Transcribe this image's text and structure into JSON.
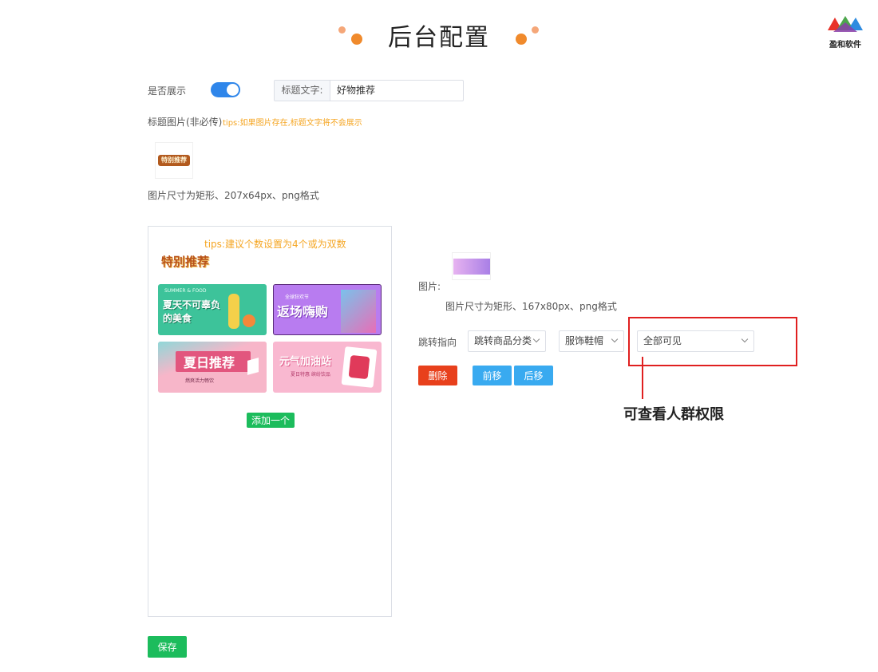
{
  "header": {
    "title": "后台配置",
    "logo_text": "盈和软件",
    "accent_color": "#f08a2c"
  },
  "display_toggle": {
    "label": "是否展示",
    "on": true
  },
  "title_text": {
    "prefix": "标题文字:",
    "value": "好物推荐"
  },
  "title_image": {
    "label": "标题图片(非必传)",
    "tip": "tips:如果图片存在,标题文字将不会展示",
    "thumb_text": "特别推荐",
    "size_hint": "图片尺寸为矩形、207x64px、png格式"
  },
  "preview": {
    "tip": "tips:建议个数设置为4个或为双数",
    "title_img_text": "特别推荐",
    "banners": [
      {
        "text": "夏天不可辜负的美食",
        "sub": "SUMMER & FOOD",
        "bg": "#3dc39a"
      },
      {
        "text": "返场嗨购",
        "sub": "全球狂欢节",
        "bg": "#b87cf0"
      },
      {
        "text": "夏日推荐",
        "sub": "燃爽活力畅饮",
        "bg": "#f7b6c9"
      },
      {
        "text": "元气加油站",
        "sub": "夏日特惠 缤纷饮品",
        "bg": "#f9b8d0"
      }
    ],
    "add_button": "添加一个"
  },
  "editor": {
    "image_label": "图片:",
    "image_size_hint": "图片尺寸为矩形、167x80px、png格式",
    "jump_label": "跳转指向",
    "jump_type": "跳转商品分类",
    "category": "服饰鞋帽",
    "visibility": "全部可见",
    "delete_button": "删除",
    "move_forward_button": "前移",
    "move_back_button": "后移"
  },
  "annotation": {
    "text": "可查看人群权限",
    "color": "#e02020"
  },
  "save_button": "保存"
}
